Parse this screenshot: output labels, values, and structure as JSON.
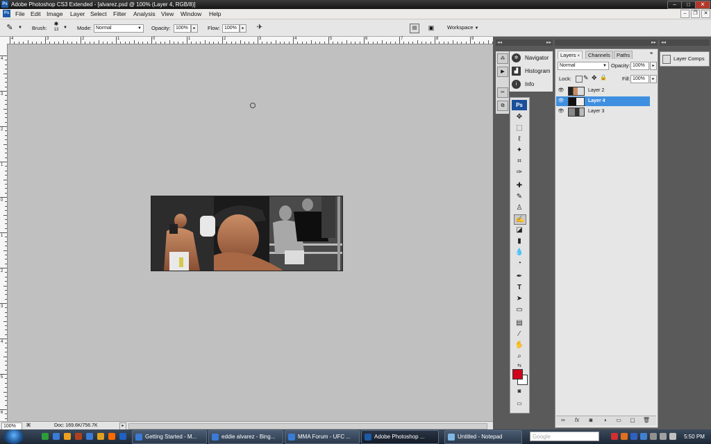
{
  "window": {
    "title": "Adobe Photoshop CS3 Extended - [alvarez.psd @ 100% (Layer 4, RGB/8)]",
    "controls": [
      "minimize",
      "maximize",
      "close"
    ]
  },
  "menubar": {
    "app_badge": "Ps",
    "items": [
      "File",
      "Edit",
      "Image",
      "Layer",
      "Select",
      "Filter",
      "Analysis",
      "View",
      "Window",
      "Help"
    ]
  },
  "options_bar": {
    "brush_label": "Brush:",
    "brush_size": "13",
    "mode_label": "Mode:",
    "mode_value": "Normal",
    "opacity_label": "Opacity:",
    "opacity_value": "100%",
    "flow_label": "Flow:",
    "flow_value": "100%",
    "workspace_label": "Workspace"
  },
  "rulers": {
    "horizontal": [
      "4",
      "3",
      "2",
      "1",
      "0",
      "1",
      "2",
      "3",
      "4",
      "5",
      "6",
      "7",
      "8",
      "9"
    ],
    "vertical": [
      "4",
      "3",
      "2",
      "1",
      "0",
      "1",
      "2",
      "3",
      "4",
      "5",
      "6"
    ]
  },
  "status": {
    "zoom": "100%",
    "doc": "Doc: 169.6K/756.7K"
  },
  "navigator_panel": {
    "items": [
      "Navigator",
      "Histogram",
      "Info"
    ]
  },
  "toolbox": {
    "logo": "Ps",
    "foreground_color": "#d0021b",
    "background_color": "#ffffff"
  },
  "layers_panel": {
    "tabs": [
      "Layers",
      "Channels",
      "Paths"
    ],
    "blend_mode": "Normal",
    "opacity_label": "Opacity:",
    "opacity_value": "100%",
    "lock_label": "Lock:",
    "fill_label": "Fill:",
    "fill_value": "100%",
    "layers": [
      {
        "name": "Layer 2",
        "selected": false
      },
      {
        "name": "Layer 4",
        "selected": true
      },
      {
        "name": "Layer 3",
        "selected": false
      }
    ]
  },
  "comps_panel": {
    "title": "Layer Comps"
  },
  "taskbar": {
    "tasks": [
      {
        "label": "Getting Started - M...",
        "color": "#3a7bd5",
        "active": false
      },
      {
        "label": "eddie alvarez - Bing...",
        "color": "#3a7bd5",
        "active": false
      },
      {
        "label": "MMA Forum - UFC ...",
        "color": "#3a7bd5",
        "active": false
      },
      {
        "label": "Adobe Photoshop ...",
        "color": "#1c5aa6",
        "active": true
      },
      {
        "label": "Untitled - Notepad",
        "color": "#7fb6e6",
        "active": false
      }
    ],
    "search_placeholder": "Google",
    "clock": "5:50 PM"
  }
}
